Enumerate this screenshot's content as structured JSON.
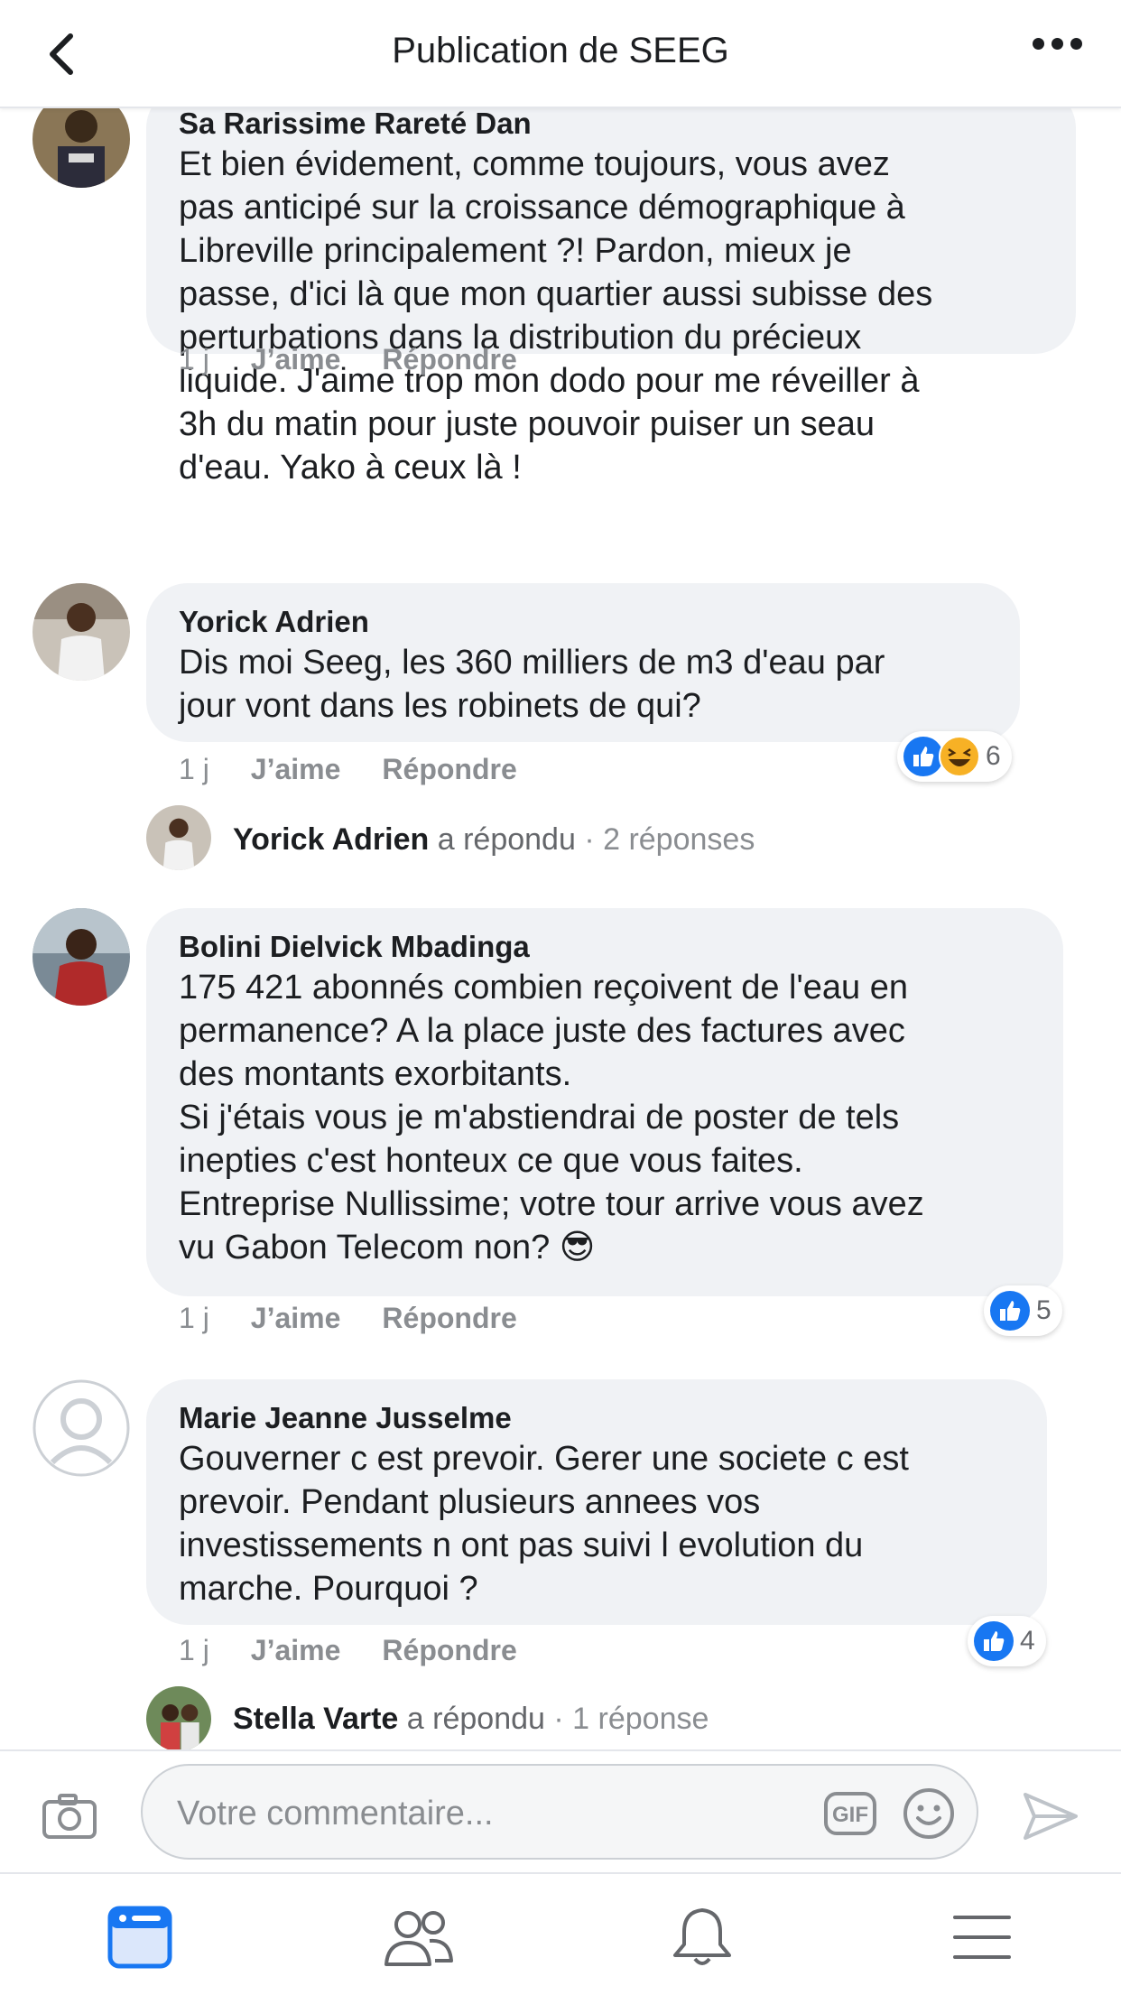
{
  "header": {
    "title": "Publication de SEEG",
    "back_icon": "chevron-left-icon",
    "more_icon": "more-horizontal-icon"
  },
  "comments": [
    {
      "name": "Sa Rarissime Rareté Dan",
      "text": "Et bien évidement, comme toujours, vous avez\npas anticipé sur la croissance démographique à\nLibreville principalement ?! Pardon, mieux je\npasse, d'ici là que mon quartier aussi subisse des\nperturbations dans la distribution du précieux\nliquide. J'aime trop mon dodo pour me réveiller à\n3h du matin pour juste pouvoir puiser un seau\nd'eau. Yako à ceux là !",
      "time": "1 j",
      "like": "J’aime",
      "reply": "Répondre"
    },
    {
      "name": "Yorick Adrien",
      "text": "Dis moi Seeg, les 360 milliers de m3 d'eau par\njour vont dans les robinets de qui?",
      "time": "1 j",
      "like": "J’aime",
      "reply": "Répondre",
      "reactions_count": "6",
      "reply_summary": {
        "name": "Yorick Adrien",
        "verb": "a répondu",
        "count": "· 2 réponses"
      }
    },
    {
      "name": "Bolini Dielvick Mbadinga",
      "text": "175 421 abonnés combien reçoivent de l'eau en\npermanence? A la place juste des factures avec\ndes montants exorbitants.\nSi j'étais vous je m'abstiendrai de poster de tels\ninepties c'est honteux ce que vous faites.\nEntreprise Nullissime; votre tour arrive vous avez\nvu Gabon Telecom non? 😎",
      "time": "1 j",
      "like": "J’aime",
      "reply": "Répondre",
      "reactions_count": "5"
    },
    {
      "name": "Marie Jeanne Jusselme",
      "text": "Gouverner c est prevoir. Gerer une societe c est\nprevoir. Pendant plusieurs annees vos\ninvestissements n ont pas suivi l evolution du\nmarche. Pourquoi ?",
      "time": "1 j",
      "like": "J’aime",
      "reply": "Répondre",
      "reactions_count": "4",
      "reply_summary": {
        "name": "Stella Varte",
        "verb": "a répondu",
        "count": "· 1 réponse"
      }
    }
  ],
  "composer": {
    "placeholder": "Votre commentaire...",
    "gif_label": "GIF"
  },
  "colors": {
    "accent": "#1877f2",
    "bubble": "#f0f2f5",
    "muted": "#8a8d91",
    "haha": "#f7b125"
  }
}
